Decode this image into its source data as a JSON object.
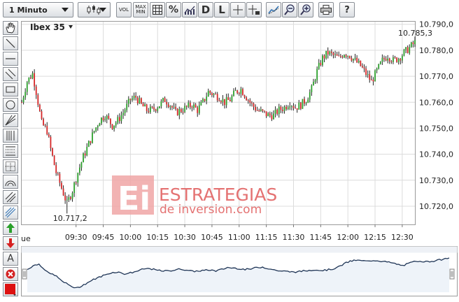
{
  "toolbar": {
    "interval": "1 Minuto",
    "vol_label": "VOL",
    "maxmin_label_1": "MAX",
    "maxmin_label_2": "MIN",
    "percent_label": "%",
    "daily_label": "D",
    "log_label": "L"
  },
  "chart": {
    "symbol": "Ibex 35",
    "watermark_line1": "ESTRATEGIAS",
    "watermark_line2": "de inversion.com",
    "high_label": "10.785,3",
    "low_label": "10.717,2",
    "first_x_label": "ue",
    "colors": {
      "up": "#2ca02c",
      "down": "#d62728",
      "wick": "#222222",
      "nav_line": "#1f3556",
      "watermark": "#e05a5a"
    }
  },
  "chart_data": {
    "type": "candlestick",
    "x_tick_labels": [
      "09:30",
      "09:45",
      "10:00",
      "10:15",
      "10:30",
      "10:45",
      "11:00",
      "11:15",
      "11:30",
      "11:45",
      "12:00",
      "12:15",
      "12:30"
    ],
    "y_tick_labels": [
      "10.720,0",
      "10.730,0",
      "10.740,0",
      "10.750,0",
      "10.760,0",
      "10.770,0",
      "10.780,0",
      "10.790,0"
    ],
    "ylim": [
      10713,
      10791
    ],
    "xlim": [
      "09:00",
      "12:37"
    ],
    "high": 10785.3,
    "low": 10717.2,
    "path": [
      [
        0,
        10760
      ],
      [
        3,
        10768
      ],
      [
        6,
        10771
      ],
      [
        8,
        10764
      ],
      [
        11,
        10752
      ],
      [
        14,
        10749
      ],
      [
        16,
        10742
      ],
      [
        19,
        10733
      ],
      [
        22,
        10727
      ],
      [
        25,
        10721
      ],
      [
        28,
        10726
      ],
      [
        31,
        10733
      ],
      [
        34,
        10739
      ],
      [
        37,
        10744
      ],
      [
        40,
        10749
      ],
      [
        43,
        10753
      ],
      [
        46,
        10755
      ],
      [
        50,
        10751
      ],
      [
        53,
        10753
      ],
      [
        56,
        10756
      ],
      [
        60,
        10761
      ],
      [
        63,
        10762
      ],
      [
        66,
        10759
      ],
      [
        69,
        10757
      ],
      [
        72,
        10757
      ],
      [
        76,
        10759
      ],
      [
        79,
        10761
      ],
      [
        82,
        10759
      ],
      [
        85,
        10756
      ],
      [
        88,
        10757
      ],
      [
        91,
        10758
      ],
      [
        94,
        10759
      ],
      [
        97,
        10757
      ],
      [
        100,
        10760
      ],
      [
        103,
        10764
      ],
      [
        106,
        10763
      ],
      [
        109,
        10762
      ],
      [
        112,
        10760
      ],
      [
        115,
        10761
      ],
      [
        118,
        10764
      ],
      [
        121,
        10765
      ],
      [
        124,
        10762
      ],
      [
        127,
        10759
      ],
      [
        130,
        10757
      ],
      [
        133,
        10756
      ],
      [
        136,
        10755
      ],
      [
        139,
        10755
      ],
      [
        142,
        10757
      ],
      [
        145,
        10758
      ],
      [
        148,
        10760
      ],
      [
        151,
        10758
      ],
      [
        154,
        10759
      ],
      [
        157,
        10761
      ],
      [
        160,
        10765
      ],
      [
        163,
        10772
      ],
      [
        166,
        10777
      ],
      [
        169,
        10779
      ],
      [
        172,
        10778
      ],
      [
        175,
        10777
      ],
      [
        178,
        10779
      ],
      [
        181,
        10778
      ],
      [
        184,
        10776
      ],
      [
        187,
        10774
      ],
      [
        190,
        10771
      ],
      [
        193,
        10768
      ],
      [
        196,
        10772
      ],
      [
        199,
        10776
      ],
      [
        202,
        10778
      ],
      [
        205,
        10776
      ],
      [
        208,
        10777
      ],
      [
        211,
        10779
      ],
      [
        214,
        10781
      ],
      [
        217,
        10783
      ],
      [
        220,
        10779
      ],
      [
        223,
        10782
      ],
      [
        226,
        10783
      ],
      [
        229,
        10782
      ],
      [
        232,
        10781
      ],
      [
        236,
        10783
      ]
    ],
    "grid": true,
    "navigator": {
      "type": "line"
    }
  }
}
